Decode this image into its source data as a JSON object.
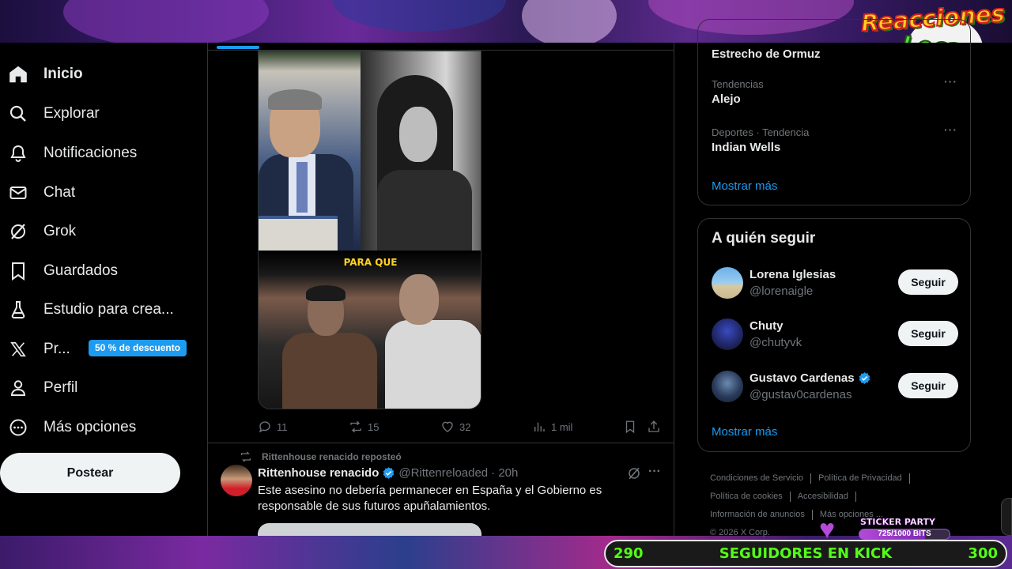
{
  "colors": {
    "accent": "#1d9bf0",
    "background": "#000000",
    "text": "#e7e9ea",
    "muted": "#71767b",
    "kick_green": "#53fc18"
  },
  "overlay": {
    "logo_line1": "Reacciones",
    "logo_line2": "Locas"
  },
  "sidebar": {
    "items": [
      {
        "label": "Inicio",
        "icon": "home-icon"
      },
      {
        "label": "Explorar",
        "icon": "search-icon"
      },
      {
        "label": "Notificaciones",
        "icon": "bell-icon"
      },
      {
        "label": "Chat",
        "icon": "mail-icon"
      },
      {
        "label": "Grok",
        "icon": "grok-icon"
      },
      {
        "label": "Guardados",
        "icon": "bookmark-icon"
      },
      {
        "label": "Estudio para crea...",
        "icon": "flask-icon"
      },
      {
        "label": "Pr...",
        "icon": "x-logo-icon"
      },
      {
        "label": "Perfil",
        "icon": "person-icon"
      },
      {
        "label": "Más opciones",
        "icon": "more-circle-icon"
      }
    ],
    "premium_badge": "50 % de descuento",
    "post_button": "Postear"
  },
  "feed": {
    "tweet1": {
      "image_caption": "PARA QUE",
      "actions": {
        "replies": "11",
        "reposts": "15",
        "likes": "32",
        "views": "1 mil"
      }
    },
    "tweet2": {
      "repost_by": "Rittenhouse renacido reposteó",
      "author_name": "Rittenhouse renacido",
      "author_handle": "@Rittenreloaded",
      "time": "· 20h",
      "text": "Este asesino no debería permanecer en España y el Gobierno es responsable de sus futuros apuñalamientos."
    }
  },
  "trends": {
    "partial_title": "Estrecho de Ormuz",
    "items": [
      {
        "meta": "Tendencias",
        "title": "Alejo"
      },
      {
        "meta": "Deportes · Tendencia",
        "title": "Indian Wells"
      }
    ],
    "show_more": "Mostrar más"
  },
  "who_to_follow": {
    "title": "A quién seguir",
    "users": [
      {
        "name": "Lorena Iglesias",
        "handle": "@lorenaigle",
        "verified": false,
        "button": "Seguir"
      },
      {
        "name": "Chuty",
        "handle": "@chutyvk",
        "verified": false,
        "button": "Seguir"
      },
      {
        "name": "Gustavo Cardenas",
        "handle": "@gustav0cardenas",
        "verified": true,
        "button": "Seguir"
      }
    ],
    "show_more": "Mostrar más"
  },
  "footer": {
    "terms": "Condiciones de Servicio",
    "privacy": "Política de Privacidad",
    "cookies": "Política de cookies",
    "accessibility": "Accesibilidad",
    "ads": "Información de anuncios",
    "more": "Más opciones ...",
    "copyright": "© 2026 X Corp."
  },
  "stream": {
    "sticker_label": "STICKER PARTY",
    "sticker_progress_text": "725/1000 BITS",
    "sticker_progress": 0.725,
    "kick_start": "290",
    "kick_label": "SEGUIDORES EN KICK",
    "kick_end": "300",
    "kick_progress": 0.0
  }
}
